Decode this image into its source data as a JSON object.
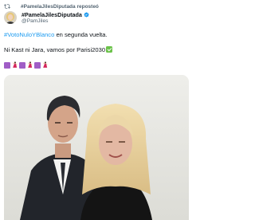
{
  "repost": {
    "text": "#PamelaJilesDiputada reposteó"
  },
  "author": {
    "name": "#PamelaJilesDiputada",
    "handle": "@PamJiles",
    "verified": true
  },
  "tweet": {
    "hashtag": "#VotoNuloYBlanco",
    "line1_rest": " en segunda vuelta.",
    "line2": "Ni Kast ni Jara, vamos por Parisi2030"
  },
  "emojis": [
    "purple-square",
    "dancer",
    "purple-square",
    "dancer",
    "purple-square",
    "dancer"
  ],
  "colors": {
    "link": "#1d9bf0",
    "muted": "#536471",
    "emoji_square": "#a05ec6",
    "emoji_dancer": "#d4245a",
    "check": "#6cc24a"
  }
}
